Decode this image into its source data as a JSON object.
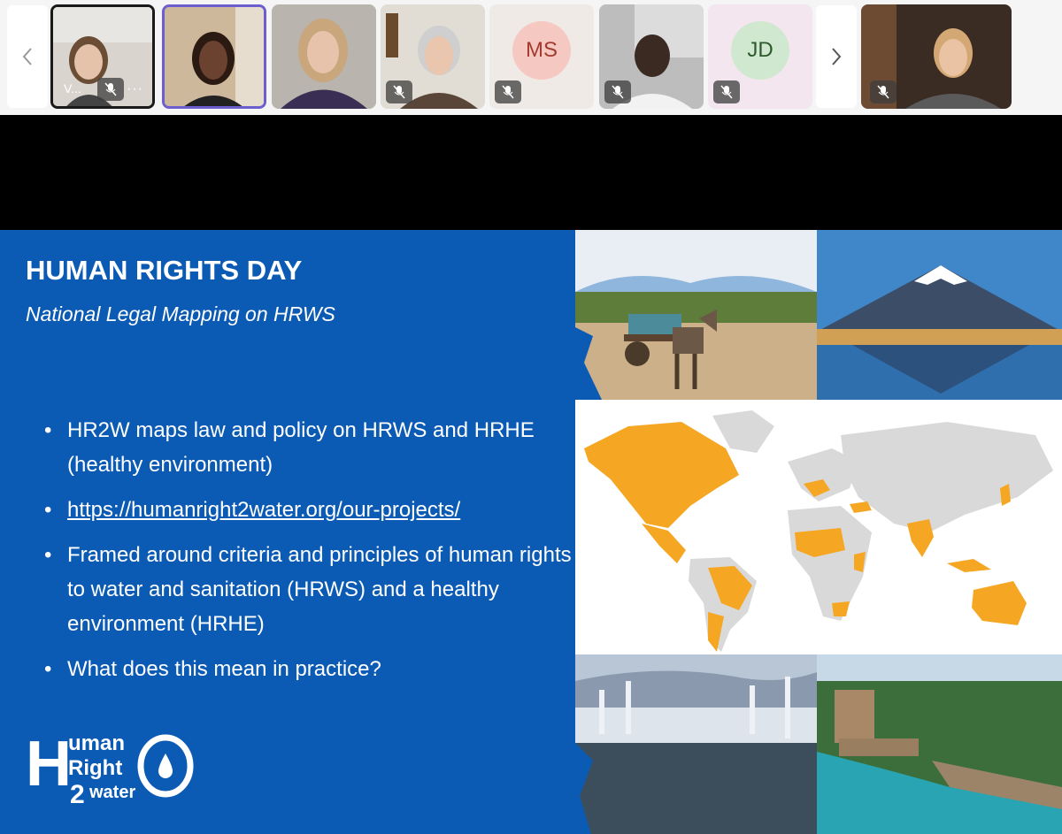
{
  "participants": [
    {
      "name": "V...",
      "more": "···",
      "muted": true
    },
    {
      "name": "",
      "muted": false
    },
    {
      "name": "",
      "muted": false
    },
    {
      "name": "",
      "muted": true
    },
    {
      "initials": "MS",
      "muted": true
    },
    {
      "name": "",
      "muted": true
    },
    {
      "initials": "JD",
      "muted": true
    },
    {
      "name": "",
      "muted": true
    }
  ],
  "nav": {
    "prev_icon": "chevron-left-icon",
    "next_icon": "chevron-right-icon"
  },
  "slide": {
    "title": "HUMAN RIGHTS DAY",
    "subtitle": "National Legal Mapping on HRWS",
    "bullets": [
      "HR2W maps law and policy on HRWS and HRHE (healthy environment)",
      "https://humanright2water.org/our-projects/",
      "Framed around criteria and principles of human rights to water and sanitation (HRWS) and a healthy environment (HRHE)",
      "What does this mean in practice?"
    ],
    "logo": {
      "letter": "H",
      "line1": "uman",
      "line2": "Right",
      "line3": "2",
      "line4": "water"
    }
  },
  "colors": {
    "slide_bg": "#0b5bb5",
    "map_highlight": "#f5a623",
    "map_base": "#d9d9d9",
    "active_border": "#6b5fd0"
  }
}
